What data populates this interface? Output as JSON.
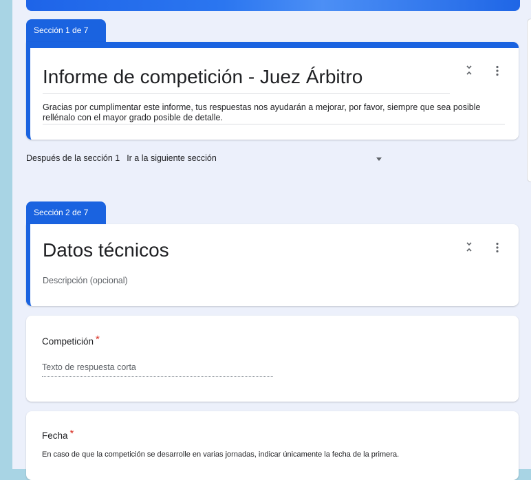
{
  "sections": [
    {
      "tab_label": "Sección 1 de 7",
      "title": "Informe de competición - Juez Árbitro",
      "description": "Gracias por cumplimentar este informe, tus respuestas nos ayudarán a mejorar, por favor, siempre que sea posible rellénalo con el mayor grado posible de detalle.",
      "after_label": "Después de la sección 1",
      "after_value": "Ir a la siguiente sección"
    },
    {
      "tab_label": "Sección 2 de 7",
      "title": "Datos técnicos",
      "description_placeholder": "Descripción (opcional)"
    }
  ],
  "questions": [
    {
      "title": "Competición",
      "required_mark": "*",
      "answer_placeholder": "Texto de respuesta corta"
    },
    {
      "title": "Fecha",
      "required_mark": "*",
      "description": "En caso de que la competición se desarrolle en varias jornadas, indicar únicamente la fecha de la primera."
    }
  ],
  "icons": {
    "collapse": "collapse-icon",
    "more": "more-vert-icon",
    "dropdown": "arrow-drop-down-icon"
  },
  "colors": {
    "accent": "#1a63e0",
    "background": "#ecf0fb",
    "required": "#d93025"
  }
}
